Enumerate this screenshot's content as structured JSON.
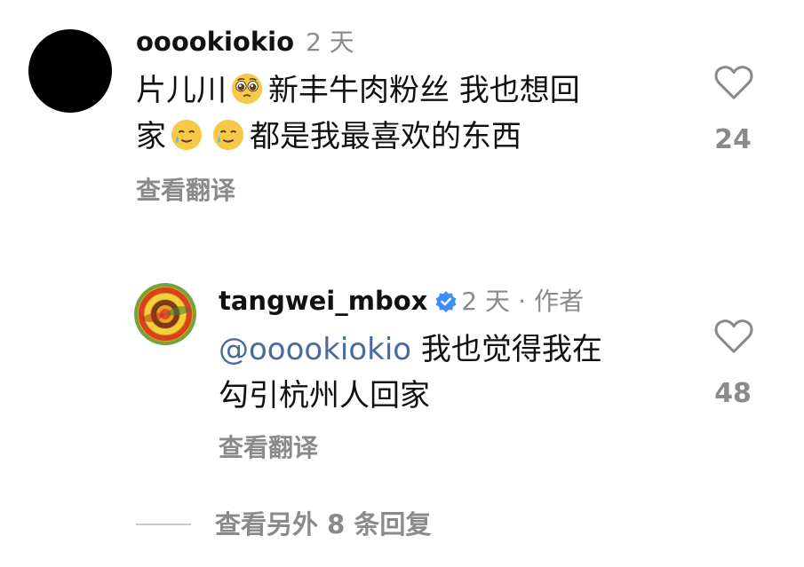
{
  "comment": {
    "username": "ooookiokio",
    "time": "2 天",
    "line1_part1": "片儿川",
    "line1_part2": "新丰牛肉粉丝 我也想回",
    "line2_part1": "家",
    "line2_part2": "都是我最喜欢的东西",
    "translate": "查看翻译",
    "likes": "24",
    "icons": {
      "like": "heart-outline-icon",
      "emoji_pleading": "pleading-face-emoji",
      "emoji_tear": "smiling-face-with-tear-emoji"
    }
  },
  "reply": {
    "username": "tangwei_mbox",
    "time": "2 天",
    "separator": "·",
    "author_label": "作者",
    "mention": "@ooookiokio",
    "line1_rest": "我也觉得我在",
    "line2": "勾引杭州人回家",
    "translate": "查看翻译",
    "likes": "48",
    "icons": {
      "verified": "verified-badge-icon",
      "like": "heart-outline-icon"
    }
  },
  "more_replies": "查看另外 8 条回复",
  "colors": {
    "text": "#111111",
    "muted": "#8a8a8a",
    "mention": "#4a6a9c",
    "verified": "#3d8ef7",
    "divider": "#c9c9c9"
  }
}
